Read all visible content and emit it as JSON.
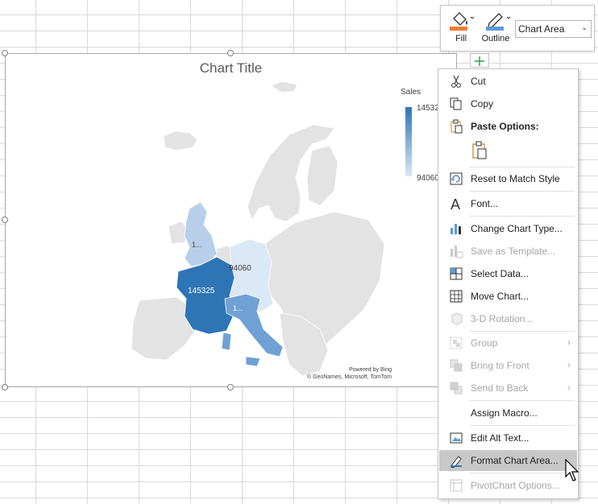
{
  "chart": {
    "title": "Chart Title",
    "legend_title": "Sales",
    "legend_max": "14532",
    "legend_min": "94060",
    "labels": {
      "france": "145325",
      "germany": "94060",
      "uk": "1...",
      "italy": "1..."
    },
    "attribution_1": "Powered by Bing",
    "attribution_2": "© GeoNames, Microsoft, TomTom",
    "colors": {
      "france": "#2e75b6",
      "italy": "#6fa1d4",
      "uk": "#b7cfe9",
      "germany": "#dbe8f6",
      "other": "#e3e3e3"
    }
  },
  "toolbar": {
    "fill_label": "Fill",
    "outline_label": "Outline",
    "element_select": "Chart Area"
  },
  "menu": {
    "items": [
      {
        "label": "Cut",
        "icon": "scissors-icon"
      },
      {
        "label": "Copy",
        "icon": "copy-icon"
      },
      {
        "label": "Paste Options:",
        "icon": "paste-icon"
      },
      {
        "label": "Reset to Match Style",
        "icon": "reset-style-icon"
      },
      {
        "label": "Font...",
        "icon": "font-icon"
      },
      {
        "label": "Change Chart Type...",
        "icon": "chart-type-icon"
      },
      {
        "label": "Save as Template...",
        "icon": "template-icon"
      },
      {
        "label": "Select Data...",
        "icon": "select-data-icon"
      },
      {
        "label": "Move Chart...",
        "icon": "move-chart-icon"
      },
      {
        "label": "3-D Rotation...",
        "icon": "rotation-3d-icon"
      },
      {
        "label": "Group",
        "icon": "group-icon"
      },
      {
        "label": "Bring to Front",
        "icon": "bring-front-icon"
      },
      {
        "label": "Send to Back",
        "icon": "send-back-icon"
      },
      {
        "label": "Assign Macro...",
        "icon": "macro-icon"
      },
      {
        "label": "Edit Alt Text...",
        "icon": "alt-text-icon"
      },
      {
        "label": "Format Chart Area...",
        "icon": "format-area-icon"
      },
      {
        "label": "PivotChart Options...",
        "icon": "pivot-options-icon"
      }
    ]
  }
}
